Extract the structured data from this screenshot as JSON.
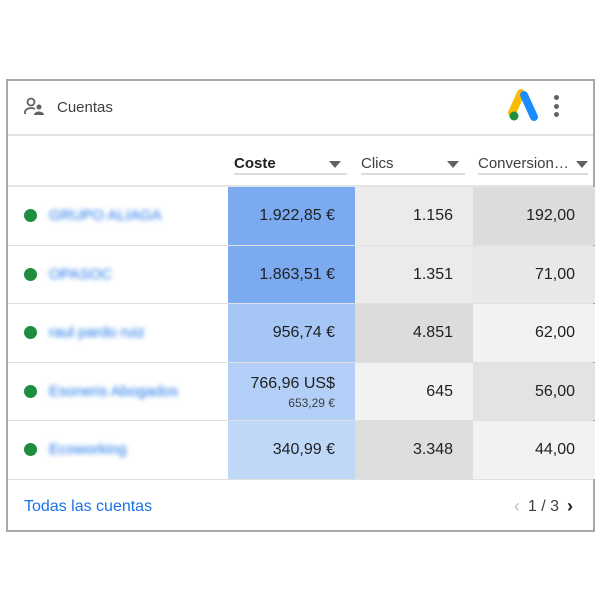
{
  "header": {
    "title": "Cuentas",
    "icon": "accounts-icon",
    "logo": "google-ads-logo"
  },
  "columns": [
    "Coste",
    "Clics",
    "Conversion…"
  ],
  "rows": [
    {
      "name": "GRUPO ALIAGA",
      "status_color": "#1e8e3e",
      "coste": "1.922,85 €",
      "coste_sub": null,
      "clics": "1.156",
      "conv": "192,00",
      "coste_bg": "#7baaf0",
      "clics_bg": "#ebebeb",
      "conv_bg": "#dcdcdc"
    },
    {
      "name": "OPASOC",
      "status_color": "#1e8e3e",
      "coste": "1.863,51 €",
      "coste_sub": null,
      "clics": "1.351",
      "conv": "71,00",
      "coste_bg": "#7caaf0",
      "clics_bg": "#ebebeb",
      "conv_bg": "#e8e8e8"
    },
    {
      "name": "raul pardo ruiz",
      "status_color": "#1e8e3e",
      "coste": "956,74 €",
      "coste_sub": null,
      "clics": "4.851",
      "conv": "62,00",
      "coste_bg": "#a6c6f5",
      "clics_bg": "#dcdcdc",
      "conv_bg": "#f2f2f2"
    },
    {
      "name": "Esoneris Abogados",
      "status_color": "#1e8e3e",
      "coste": "766,96 US$",
      "coste_sub": "653,29 €",
      "clics": "645",
      "conv": "56,00",
      "coste_bg": "#b3cff7",
      "clics_bg": "#f2f2f2",
      "conv_bg": "#e3e3e3"
    },
    {
      "name": "Ecoworking",
      "status_color": "#1e8e3e",
      "coste": "340,99 €",
      "coste_sub": null,
      "clics": "3.348",
      "conv": "44,00",
      "coste_bg": "#c0d8f8",
      "clics_bg": "#dedede",
      "conv_bg": "#f2f2f2"
    }
  ],
  "footer": {
    "link": "Todas las cuentas",
    "page": "1 / 3"
  }
}
